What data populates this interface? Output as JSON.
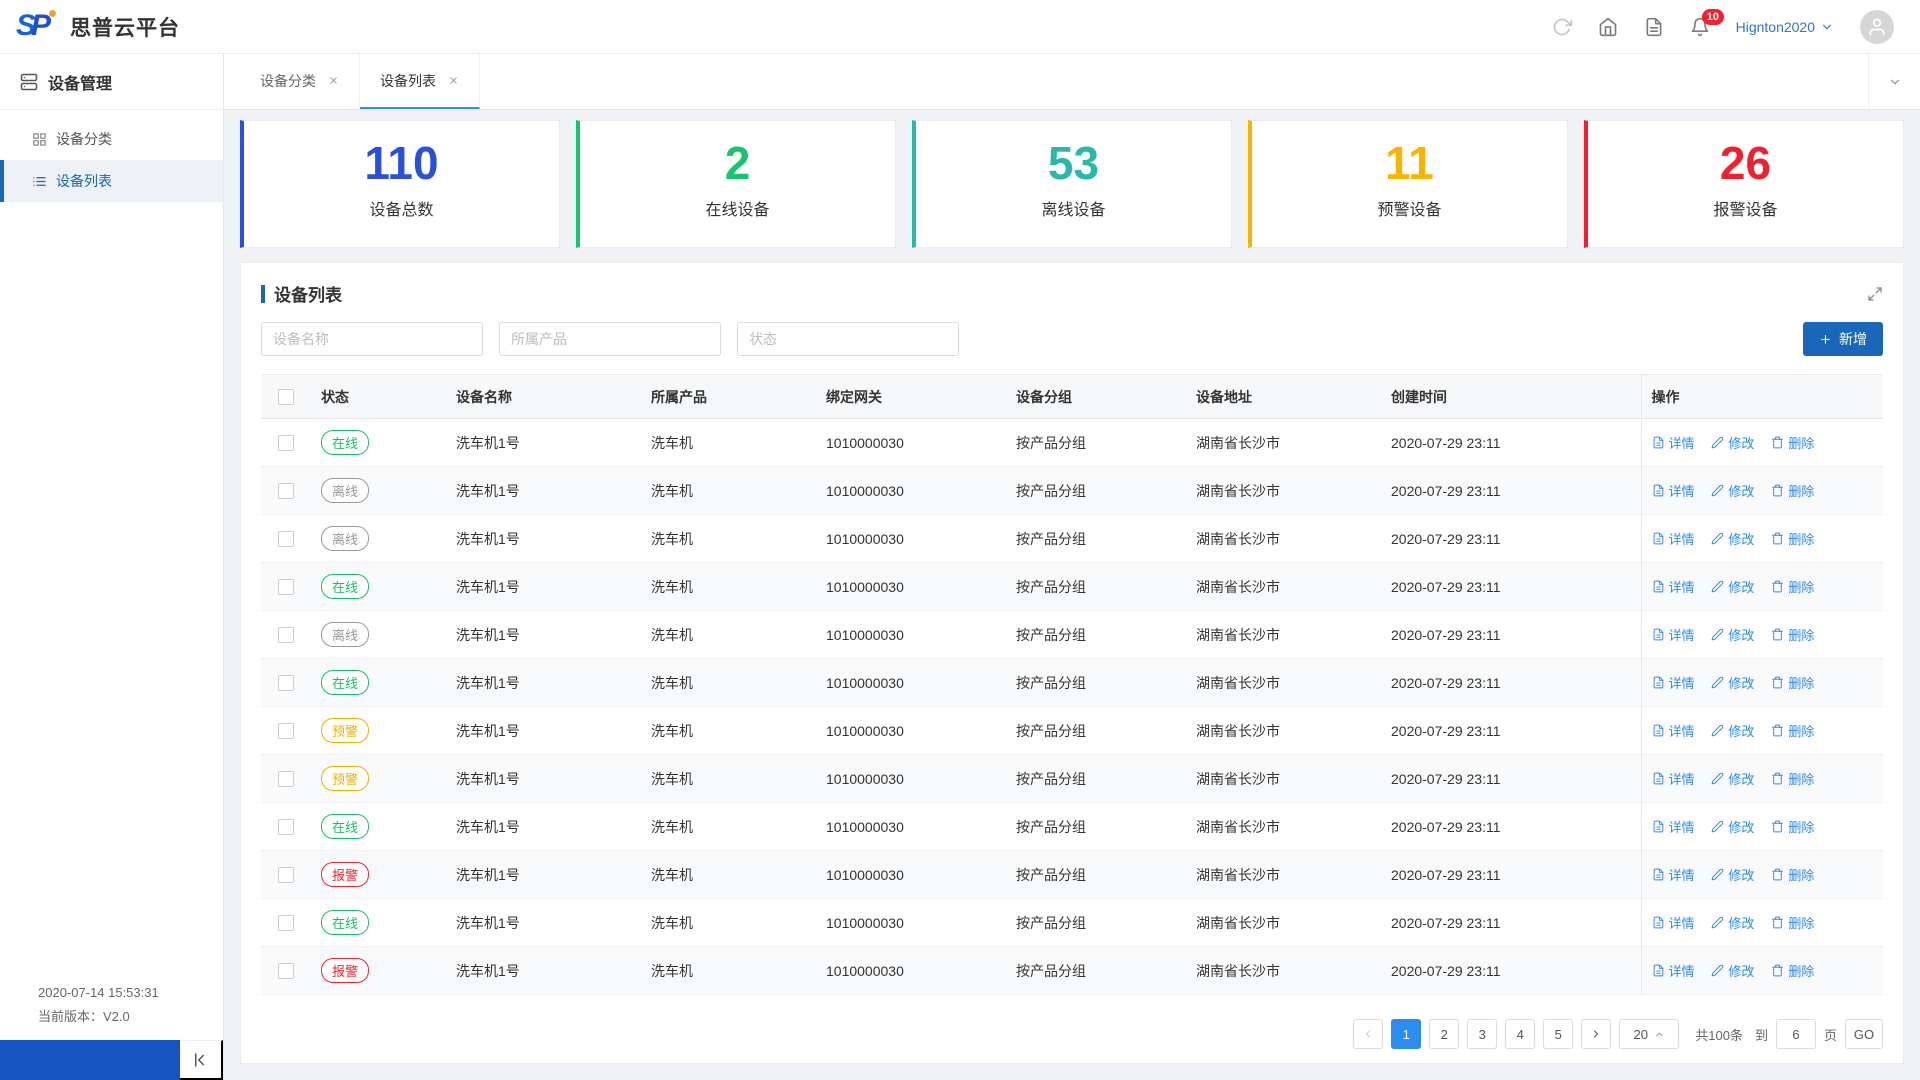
{
  "header": {
    "logo": "SP",
    "title": "思普云平台",
    "notification_badge": "10",
    "username": "Hignton2020"
  },
  "icons": {
    "refresh-icon": "circular-arrow",
    "home-icon": "house",
    "document-icon": "file-text",
    "bell-icon": "bell",
    "chevron-down-icon": "v",
    "avatar-icon": "person",
    "close-icon": "x",
    "expand-icon": "diagonal-arrows",
    "plus-icon": "+",
    "detail-icon": "file-text",
    "edit-icon": "pencil",
    "delete-icon": "trash",
    "collapse-icon": "indent-left"
  },
  "sidebar": {
    "title": "设备管理",
    "items": [
      {
        "label": "设备分类",
        "active": false
      },
      {
        "label": "设备列表",
        "active": true
      }
    ],
    "timestamp": "2020-07-14 15:53:31",
    "version": "当前版本：V2.0"
  },
  "tabs": [
    {
      "label": "设备分类",
      "active": false
    },
    {
      "label": "设备列表",
      "active": true
    }
  ],
  "stats": [
    {
      "value": "110",
      "label": "设备总数",
      "color": "#2b50d8"
    },
    {
      "value": "2",
      "label": "在线设备",
      "color": "#17c56f"
    },
    {
      "value": "53",
      "label": "离线设备",
      "color": "#2cb8a8"
    },
    {
      "value": "11",
      "label": "预警设备",
      "color": "#f7b500"
    },
    {
      "value": "26",
      "label": "报警设备",
      "color": "#f0212e"
    }
  ],
  "panel": {
    "title": "设备列表",
    "filters": [
      {
        "placeholder": "设备名称"
      },
      {
        "placeholder": "所属产品"
      },
      {
        "placeholder": "状态"
      }
    ],
    "add_button": "新增"
  },
  "table": {
    "columns": [
      "状态",
      "设备名称",
      "所属产品",
      "绑定网关",
      "设备分组",
      "设备地址",
      "创建时间",
      "操作"
    ],
    "actions": [
      "详情",
      "修改",
      "删除"
    ],
    "status_colors": {
      "online": "#19be6b",
      "offline": "#9a9a9a",
      "warning": "#efb000",
      "alarm": "#f5222d"
    },
    "rows": [
      {
        "status": "在线",
        "status_type": "online",
        "name": "洗车机1号",
        "product": "洗车机",
        "gateway": "1010000030",
        "group": "按产品分组",
        "address": "湖南省长沙市",
        "created": "2020-07-29 23:11"
      },
      {
        "status": "离线",
        "status_type": "offline",
        "name": "洗车机1号",
        "product": "洗车机",
        "gateway": "1010000030",
        "group": "按产品分组",
        "address": "湖南省长沙市",
        "created": "2020-07-29 23:11"
      },
      {
        "status": "离线",
        "status_type": "offline",
        "name": "洗车机1号",
        "product": "洗车机",
        "gateway": "1010000030",
        "group": "按产品分组",
        "address": "湖南省长沙市",
        "created": "2020-07-29 23:11"
      },
      {
        "status": "在线",
        "status_type": "online",
        "name": "洗车机1号",
        "product": "洗车机",
        "gateway": "1010000030",
        "group": "按产品分组",
        "address": "湖南省长沙市",
        "created": "2020-07-29 23:11"
      },
      {
        "status": "离线",
        "status_type": "offline",
        "name": "洗车机1号",
        "product": "洗车机",
        "gateway": "1010000030",
        "group": "按产品分组",
        "address": "湖南省长沙市",
        "created": "2020-07-29 23:11"
      },
      {
        "status": "在线",
        "status_type": "online",
        "name": "洗车机1号",
        "product": "洗车机",
        "gateway": "1010000030",
        "group": "按产品分组",
        "address": "湖南省长沙市",
        "created": "2020-07-29 23:11"
      },
      {
        "status": "预警",
        "status_type": "warning",
        "name": "洗车机1号",
        "product": "洗车机",
        "gateway": "1010000030",
        "group": "按产品分组",
        "address": "湖南省长沙市",
        "created": "2020-07-29 23:11"
      },
      {
        "status": "预警",
        "status_type": "warning",
        "name": "洗车机1号",
        "product": "洗车机",
        "gateway": "1010000030",
        "group": "按产品分组",
        "address": "湖南省长沙市",
        "created": "2020-07-29 23:11"
      },
      {
        "status": "在线",
        "status_type": "online",
        "name": "洗车机1号",
        "product": "洗车机",
        "gateway": "1010000030",
        "group": "按产品分组",
        "address": "湖南省长沙市",
        "created": "2020-07-29 23:11"
      },
      {
        "status": "报警",
        "status_type": "alarm",
        "name": "洗车机1号",
        "product": "洗车机",
        "gateway": "1010000030",
        "group": "按产品分组",
        "address": "湖南省长沙市",
        "created": "2020-07-29 23:11"
      },
      {
        "status": "在线",
        "status_type": "online",
        "name": "洗车机1号",
        "product": "洗车机",
        "gateway": "1010000030",
        "group": "按产品分组",
        "address": "湖南省长沙市",
        "created": "2020-07-29 23:11"
      },
      {
        "status": "报警",
        "status_type": "alarm",
        "name": "洗车机1号",
        "product": "洗车机",
        "gateway": "1010000030",
        "group": "按产品分组",
        "address": "湖南省长沙市",
        "created": "2020-07-29 23:11"
      }
    ]
  },
  "pagination": {
    "prev": "‹",
    "next": "›",
    "pages": [
      "1",
      "2",
      "3",
      "4",
      "5"
    ],
    "active": "1",
    "page_size": "20",
    "total": "共100条",
    "jump_before": "到",
    "jump_value": "6",
    "jump_after": "页",
    "go": "GO"
  }
}
